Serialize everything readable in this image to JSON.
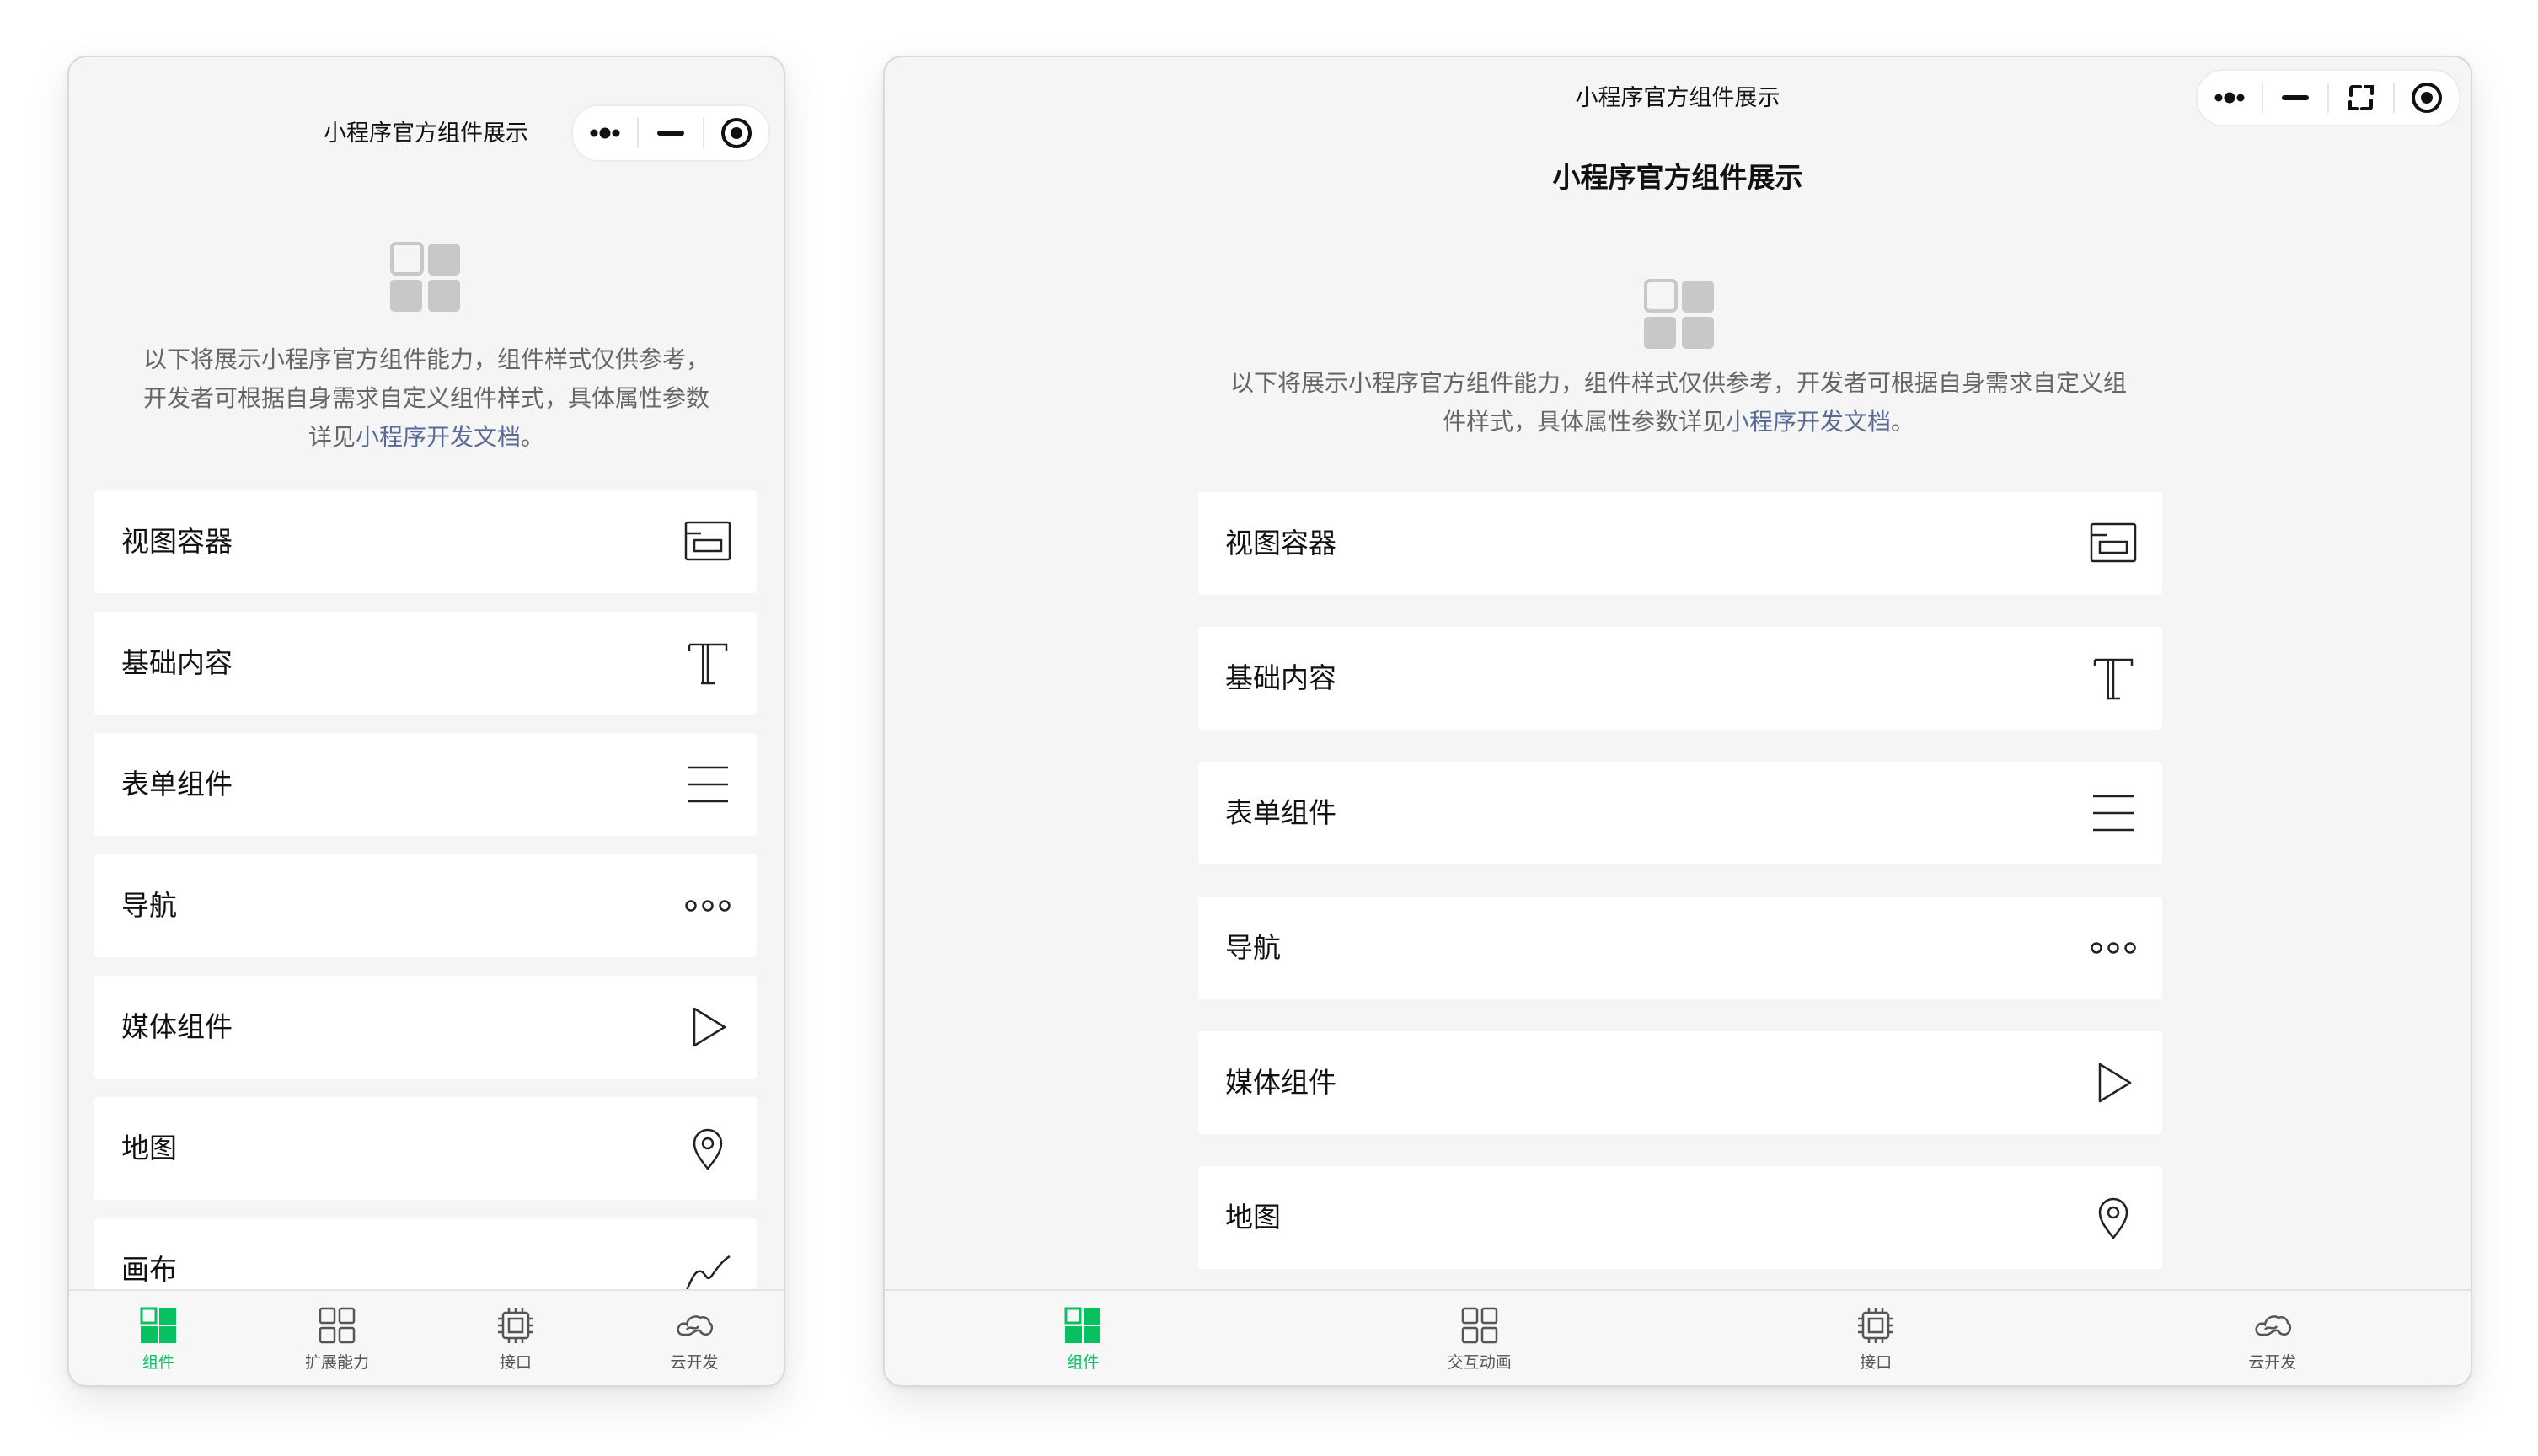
{
  "colors": {
    "accent": "#07c160",
    "link": "#576b95",
    "background": "#f5f5f5"
  },
  "left": {
    "title": "小程序官方组件展示",
    "capsule": [
      "more-icon",
      "minimize-icon",
      "record-icon"
    ],
    "intro": {
      "text": "以下将展示小程序官方组件能力，组件样式仅供参考，开发者可根据自身需求自定义组件样式，具体属性参数详见",
      "link": "小程序开发文档",
      "end": "。"
    },
    "items": [
      {
        "label": "视图容器",
        "icon": "view-container-icon"
      },
      {
        "label": "基础内容",
        "icon": "text-t-icon"
      },
      {
        "label": "表单组件",
        "icon": "form-lines-icon"
      },
      {
        "label": "导航",
        "icon": "dots-icon"
      },
      {
        "label": "媒体组件",
        "icon": "play-icon"
      },
      {
        "label": "地图",
        "icon": "map-pin-icon"
      },
      {
        "label": "画布",
        "icon": "canvas-curve-icon"
      }
    ],
    "tabs": [
      {
        "label": "组件",
        "icon": "component-grid-icon",
        "active": true
      },
      {
        "label": "扩展能力",
        "icon": "extension-grid-icon",
        "active": false
      },
      {
        "label": "接口",
        "icon": "chip-icon",
        "active": false
      },
      {
        "label": "云开发",
        "icon": "cloud-icon",
        "active": false
      }
    ]
  },
  "right": {
    "window_title": "小程序官方组件展示",
    "page_title": "小程序官方组件展示",
    "capsule": [
      "more-icon",
      "minimize-icon",
      "restore-icon",
      "record-icon"
    ],
    "intro": {
      "text": "以下将展示小程序官方组件能力，组件样式仅供参考，开发者可根据自身需求自定义组件样式，具体属性参数详见",
      "link": "小程序开发文档",
      "end": "。"
    },
    "items": [
      {
        "label": "视图容器",
        "icon": "view-container-icon"
      },
      {
        "label": "基础内容",
        "icon": "text-t-icon"
      },
      {
        "label": "表单组件",
        "icon": "form-lines-icon"
      },
      {
        "label": "导航",
        "icon": "dots-icon"
      },
      {
        "label": "媒体组件",
        "icon": "play-icon"
      },
      {
        "label": "地图",
        "icon": "map-pin-icon"
      }
    ],
    "tabs": [
      {
        "label": "组件",
        "icon": "component-grid-icon",
        "active": true
      },
      {
        "label": "交互动画",
        "icon": "animation-grid-icon",
        "active": false
      },
      {
        "label": "接口",
        "icon": "chip-icon",
        "active": false
      },
      {
        "label": "云开发",
        "icon": "cloud-icon",
        "active": false
      }
    ]
  }
}
